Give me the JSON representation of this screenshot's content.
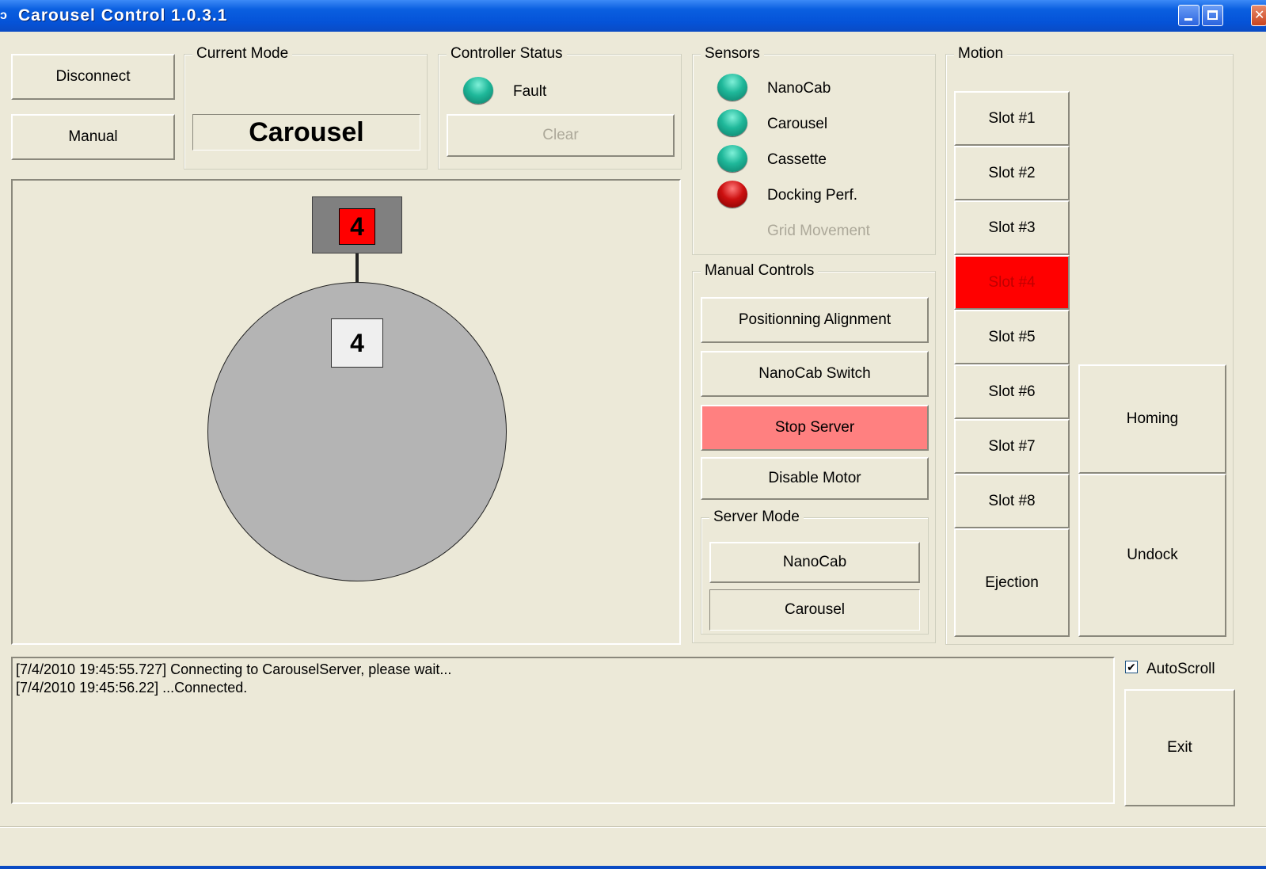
{
  "window": {
    "app_icon": "carousel-app-icon",
    "title": "Carousel Control 1.0.3.1"
  },
  "left_buttons": {
    "disconnect": "Disconnect",
    "manual": "Manual"
  },
  "current_mode": {
    "label": "Current Mode",
    "value": "Carousel"
  },
  "controller_status": {
    "label": "Controller Status",
    "indicator": {
      "name": "Fault",
      "state": "green"
    },
    "clear_label": "Clear",
    "clear_enabled": false
  },
  "carousel_view": {
    "station_slot": "4",
    "wheel_slot": "4",
    "station_color": "#ff0000"
  },
  "sensors": {
    "label": "Sensors",
    "items": [
      {
        "name": "NanoCab",
        "state": "green"
      },
      {
        "name": "Carousel",
        "state": "green"
      },
      {
        "name": "Cassette",
        "state": "green"
      },
      {
        "name": "Docking Perf.",
        "state": "red"
      },
      {
        "name": "Grid Movement",
        "state": "disabled"
      }
    ]
  },
  "manual_controls": {
    "label": "Manual Controls",
    "positioning": "Positionning Alignment",
    "nanocab_switch": "NanoCab Switch",
    "stop_server": "Stop Server",
    "disable_motor": "Disable Motor",
    "server_mode": {
      "label": "Server Mode",
      "nanocab": "NanoCab",
      "carousel": "Carousel"
    }
  },
  "motion": {
    "label": "Motion",
    "slots": [
      "Slot #1",
      "Slot #2",
      "Slot #3",
      "Slot #4",
      "Slot #5",
      "Slot #6",
      "Slot #7",
      "Slot #8"
    ],
    "active_slot": "Slot #4",
    "ejection": "Ejection",
    "homing": "Homing",
    "undock": "Undock"
  },
  "log": {
    "lines": [
      "[7/4/2010 19:45:55.727] Connecting to CarouselServer, please wait...",
      "[7/4/2010 19:45:56.22] ...Connected."
    ]
  },
  "autoscroll": {
    "label": "AutoScroll",
    "checked": true
  },
  "exit_label": "Exit",
  "colors": {
    "window_bg": "#ece9d8",
    "active_slot": "#ff0000",
    "stop_server": "#ff8080",
    "titlebar": "#0553d8"
  }
}
